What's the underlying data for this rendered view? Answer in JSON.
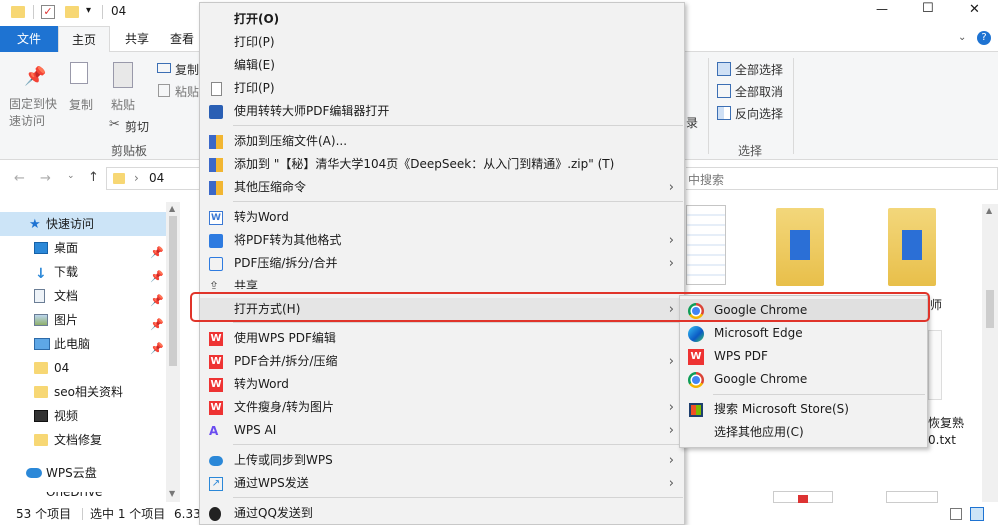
{
  "titlebar": {
    "path": "04",
    "minimize": "—",
    "maximize": "☐",
    "close": "✕"
  },
  "tabs": {
    "file": "文件",
    "home": "主页",
    "share": "共享",
    "view": "查看"
  },
  "ribbon": {
    "pin": "固定到快\n速访问",
    "copy": "复制",
    "paste": "粘贴",
    "copy_path": "复制",
    "paste_shortcut": "粘贴",
    "cut": "剪切",
    "clipboard_group": "剪贴板",
    "select_all": "全部选择",
    "select_none": "全部取消",
    "invert": "反向选择",
    "select_group": "选择",
    "history_tail": "录"
  },
  "address": {
    "path": "04",
    "search_placeholder": "中搜索"
  },
  "nav": {
    "quick_access": "快速访问",
    "items": [
      "桌面",
      "下载",
      "文档",
      "图片",
      "此电脑",
      "04",
      "seo相关资料",
      "视频",
      "文档修复"
    ],
    "cloud": "WPS云盘",
    "next_partial": "OneDrive"
  },
  "status": {
    "count": "53 个项目",
    "selected": "选中 1 个项目",
    "size": "6.33"
  },
  "files": {
    "f1_tail": "师",
    "f2_line1": "恢复熟",
    "f2_line2": "0.txt"
  },
  "menu": {
    "items": [
      {
        "label": "打开(O)",
        "bold": true
      },
      {
        "label": "打印(P)"
      },
      {
        "label": "编辑(E)"
      },
      {
        "label": "打印(P)"
      },
      {
        "label": "使用转转大师PDF编辑器打开"
      },
      {
        "label": "添加到压缩文件(A)..."
      },
      {
        "label": "添加到 \"【秘】清华大学104页《DeepSeek：从入门到精通》.zip\" (T)"
      },
      {
        "label": "其他压缩命令"
      },
      {
        "label": "转为Word"
      },
      {
        "label": "将PDF转为其他格式"
      },
      {
        "label": "PDF压缩/拆分/合并"
      },
      {
        "label": "共享"
      },
      {
        "label": "打开方式(H)"
      },
      {
        "label": "使用WPS PDF编辑"
      },
      {
        "label": "PDF合并/拆分/压缩"
      },
      {
        "label": "转为Word"
      },
      {
        "label": "文件瘦身/转为图片"
      },
      {
        "label": "WPS AI"
      },
      {
        "label": "上传或同步到WPS"
      },
      {
        "label": "通过WPS发送"
      },
      {
        "label": "通过QQ发送到"
      }
    ],
    "arrow": "›"
  },
  "submenu": {
    "items": [
      "Google Chrome",
      "Microsoft Edge",
      "WPS PDF",
      "Google Chrome",
      "搜索 Microsoft Store(S)",
      "选择其他应用(C)"
    ]
  },
  "colors": {
    "accent": "#1e73d2",
    "highlight": "#e0342a"
  }
}
